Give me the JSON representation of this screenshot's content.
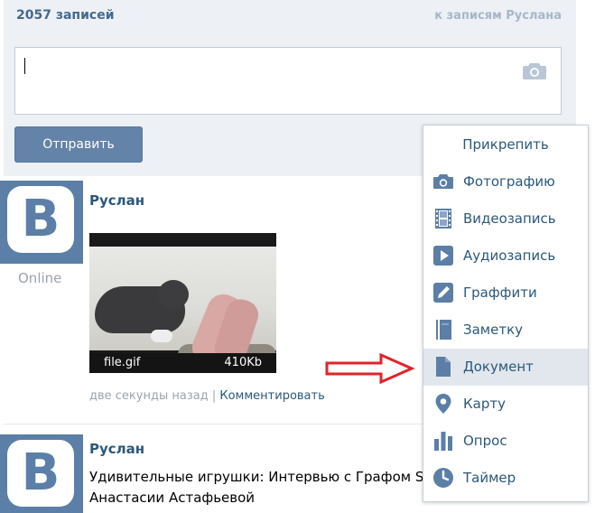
{
  "header": {
    "post_count": "2057 записей",
    "to_posts_link": "к записям Руслана"
  },
  "composer": {
    "value": "",
    "camera_icon": "camera-icon",
    "send_label": "Отправить"
  },
  "attach_menu": {
    "title": "Прикрепить",
    "items": [
      {
        "label": "Фотографию",
        "icon": "photo-icon"
      },
      {
        "label": "Видеозапись",
        "icon": "video-icon"
      },
      {
        "label": "Аудиозапись",
        "icon": "audio-icon"
      },
      {
        "label": "Граффити",
        "icon": "graffiti-icon"
      },
      {
        "label": "Заметку",
        "icon": "note-icon"
      },
      {
        "label": "Документ",
        "icon": "document-icon",
        "highlighted": true
      },
      {
        "label": "Карту",
        "icon": "map-pin-icon"
      },
      {
        "label": "Опрос",
        "icon": "poll-icon"
      },
      {
        "label": "Таймер",
        "icon": "timer-icon"
      }
    ]
  },
  "posts": [
    {
      "avatar_letter": "B",
      "status": "Online",
      "author": "Руслан",
      "attachment": {
        "file_name": "file.gif",
        "file_size": "410Kb"
      },
      "time": "две секунды назад",
      "separator": "|",
      "comment_link": "Комментировать"
    },
    {
      "avatar_letter": "B",
      "author": "Руслан",
      "text_line1": "Удивительные игрушки: Интервью с Графом S",
      "text_line2": "Анастасии Астафьевой"
    }
  ],
  "colors": {
    "brand_blue": "#5b7fa6",
    "link_blue": "#2b587a",
    "button_blue": "#6383a8",
    "panel_bg": "#edf0f4",
    "arrow_red": "#e0232a"
  }
}
